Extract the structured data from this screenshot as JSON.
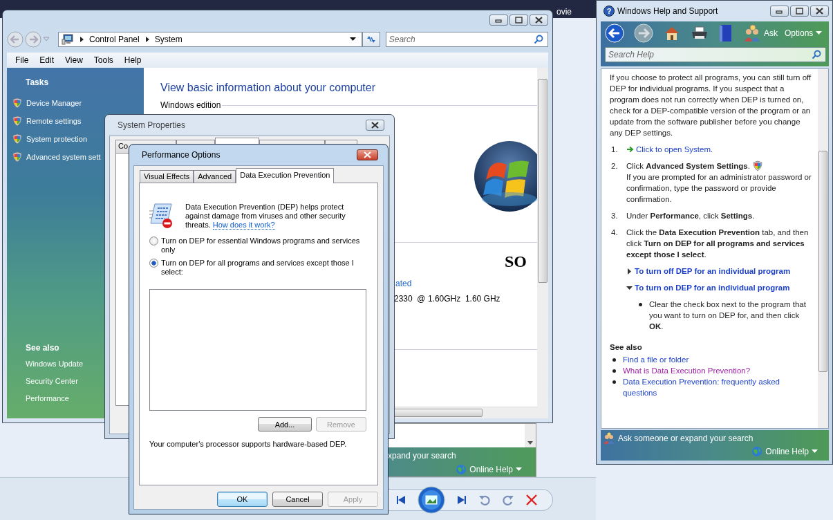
{
  "desktop": {
    "taskbar_label": "ovie"
  },
  "back_help_window": {
    "footer_text": "xpand your search",
    "online_help": "Online Help"
  },
  "control_panel": {
    "address": [
      {
        "label": "Control Panel"
      },
      {
        "label": "System"
      }
    ],
    "search": {
      "placeholder": "Search"
    },
    "menu": [
      "File",
      "Edit",
      "View",
      "Tools",
      "Help"
    ],
    "tasks_heading": "Tasks",
    "tasks": [
      "Device Manager",
      "Remote settings",
      "System protection",
      "Advanced system sett"
    ],
    "see_also_heading": "See also",
    "see_also": [
      "Windows Update",
      "Security Center",
      "Performance"
    ],
    "heading": "View basic information about your computer",
    "section": "Windows edition",
    "brand_logo": "SO",
    "rating_link": "ated",
    "processor": "2330  @ 1.60GHz  1.60 GHz"
  },
  "system_properties": {
    "title": "System Properties",
    "tabs": [
      {
        "label": "Co",
        "selected": false
      },
      {
        "selected": false
      },
      {
        "selected": true
      },
      {
        "selected": false
      },
      {
        "selected": false
      }
    ]
  },
  "performance_options": {
    "title": "Performance Options",
    "tabs": [
      {
        "label": "Visual Effects",
        "selected": false
      },
      {
        "label": "Advanced",
        "selected": false
      },
      {
        "label": "Data Execution Prevention",
        "selected": true
      }
    ],
    "description": "Data Execution Prevention (DEP) helps protect against damage from viruses and other security threats.",
    "link": "How does it work?",
    "options": [
      {
        "label": "Turn on DEP for essential Windows programs and services only",
        "selected": false
      },
      {
        "label": "Turn on DEP for all programs and services except those I select:",
        "selected": true
      }
    ],
    "list_buttons": [
      {
        "label": "Add...",
        "disabled": false
      },
      {
        "label": "Remove",
        "disabled": true
      }
    ],
    "support_note": "Your computer's processor supports hardware-based DEP.",
    "buttons": [
      {
        "label": "OK",
        "default": true,
        "disabled": false
      },
      {
        "label": "Cancel",
        "default": false,
        "disabled": false
      },
      {
        "label": "Apply",
        "default": false,
        "disabled": true
      }
    ]
  },
  "help": {
    "icon_glyph": "?",
    "title": "Windows Help and Support",
    "ask": "Ask",
    "options": "Options",
    "search": {
      "placeholder": "Search Help"
    },
    "intro": "If you choose to protect all programs, you can still turn off DEP for individual programs. If you suspect that a program does not run correctly when DEP is turned on, check for a DEP-compatible version of the program or an update from the software publisher before you change any DEP settings.",
    "steps": [
      {
        "number": "1.",
        "kind": "link",
        "text": "Click to open System."
      },
      {
        "number": "2.",
        "kind": "shield",
        "text": "Click **Advanced System Settings**.",
        "text_after": "If you are prompted for an administrator password or confirmation, type the password or provide confirmation."
      },
      {
        "number": "3.",
        "kind": "text",
        "text": "Under **Performance**, click **Settings**."
      },
      {
        "number": "4.",
        "kind": "text",
        "text": "Click the **Data Execution Prevention** tab, and then click **Turn on DEP for all programs and services except those I select**."
      }
    ],
    "sections": [
      {
        "title": "To turn off DEP for an individual program",
        "expanded": false
      },
      {
        "title": "To turn on DEP for an individual program",
        "expanded": true,
        "bullets": [
          "Clear the check box next to the program that you want to turn on DEP for, and then click **OK**."
        ]
      }
    ],
    "see_also_heading": "See also",
    "see_also": [
      {
        "label": "Find a file or folder",
        "visited": false
      },
      {
        "label": "What is Data Execution Prevention?",
        "visited": true
      },
      {
        "label": "Data Execution Prevention: frequently asked questions",
        "visited": false
      }
    ],
    "footer": {
      "ask": "Ask someone or expand your search",
      "online_help": "Online Help"
    }
  }
}
